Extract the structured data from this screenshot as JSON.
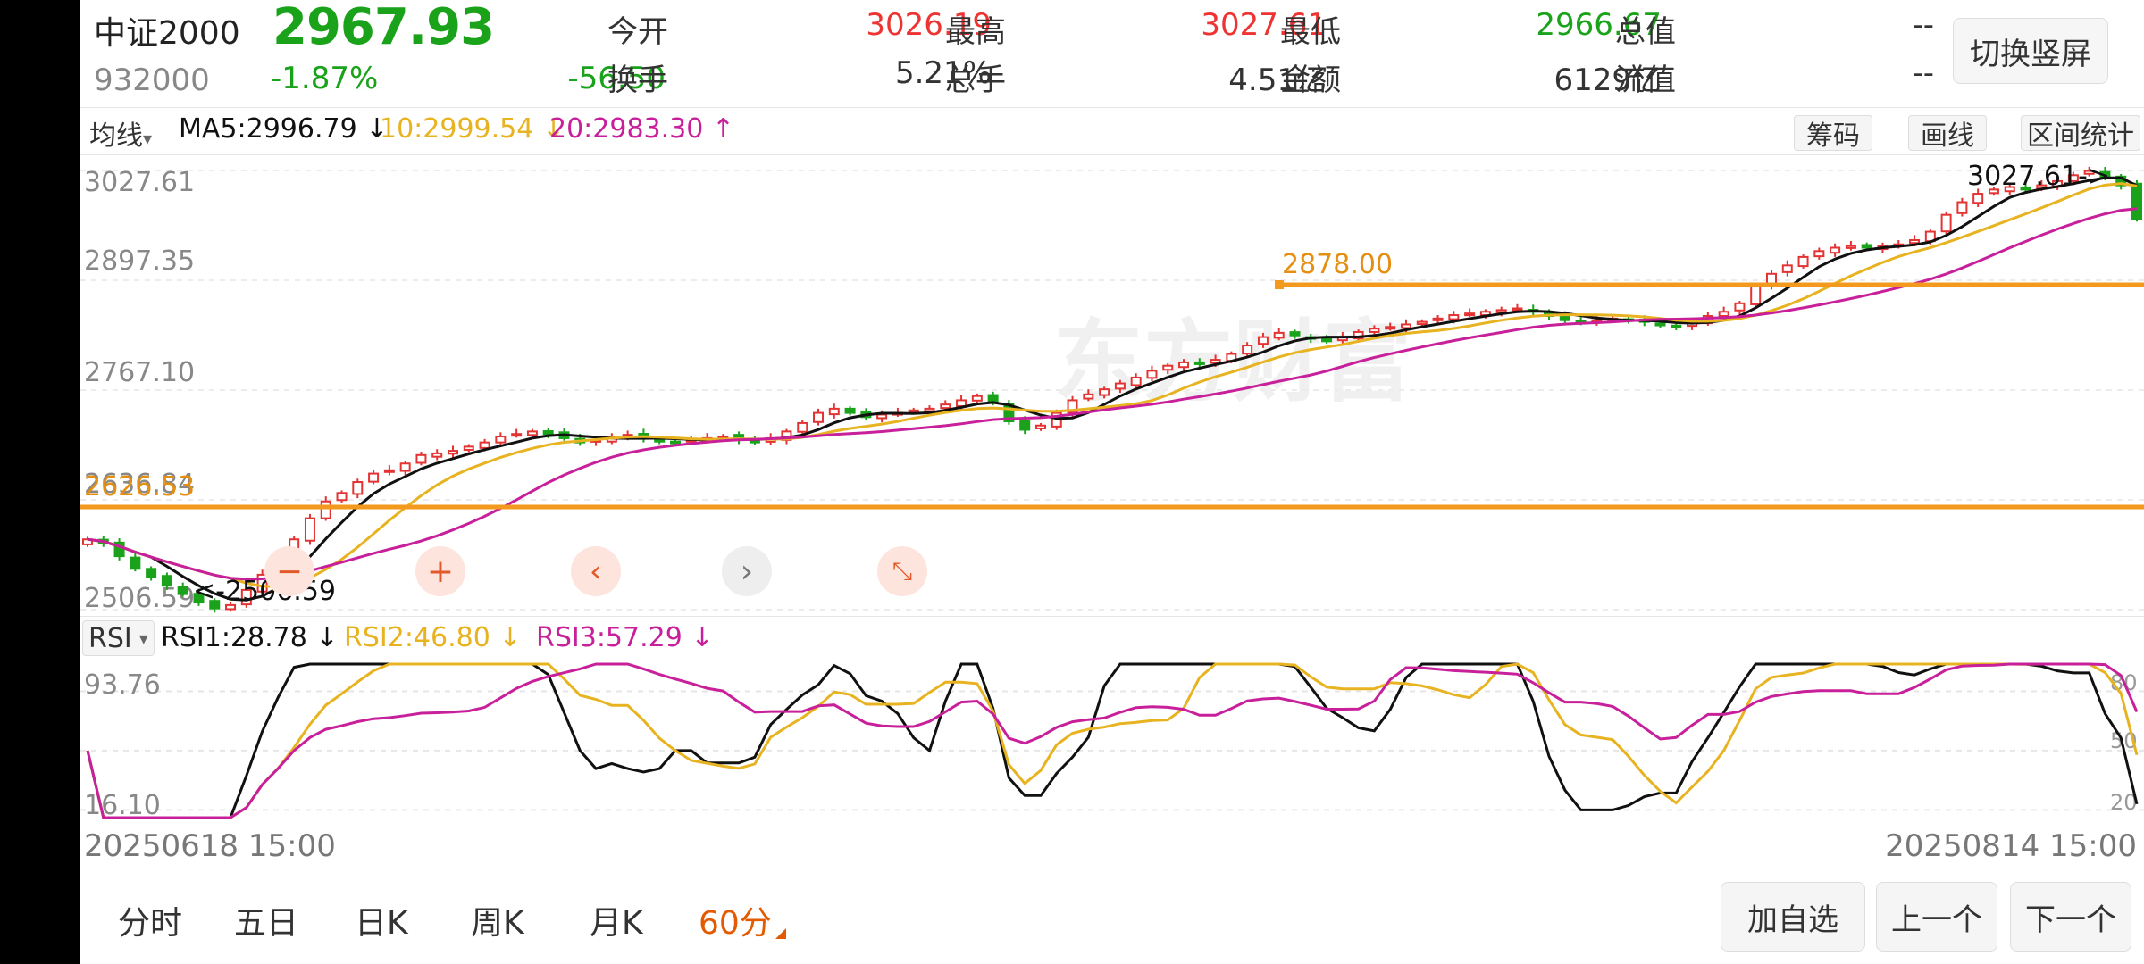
{
  "header": {
    "name": "中证2000",
    "price": "2967.93",
    "code": "932000",
    "change_pct": "-1.87%",
    "change": "-56.50",
    "stats": [
      {
        "label": "今开",
        "value": "3026.19",
        "color": "red"
      },
      {
        "label": "最高",
        "value": "3027.61",
        "color": "red"
      },
      {
        "label": "最低",
        "value": "2966.67",
        "color": "green"
      },
      {
        "label": "总值",
        "value": "--",
        "color": "dark"
      },
      {
        "label": "换手",
        "value": "5.21%",
        "color": "dark"
      },
      {
        "label": "总手",
        "value": "4.51亿",
        "color": "dark"
      },
      {
        "label": "金额",
        "value": "6129亿",
        "color": "dark"
      },
      {
        "label": "流值",
        "value": "--",
        "color": "dark"
      }
    ],
    "switch_button": "切换竖屏"
  },
  "ma_bar": {
    "selector": "均线",
    "selector_caret": "▾",
    "ma5": "MA5:2996.79 ↓",
    "ma10": "10:2999.54 ↓",
    "ma20": "20:2983.30 ↑",
    "tools": [
      "筹码",
      "画线",
      "区间统计"
    ]
  },
  "kchart": {
    "y_labels": [
      "3027.61",
      "2897.35",
      "2767.10",
      "2636.84",
      "2506.59"
    ],
    "hline_top": "2878.00",
    "hline_bottom": "2626.53",
    "max_label": "3027.61->",
    "min_label": "<-2506.59",
    "watermark": "东方财富"
  },
  "chart_data": {
    "type": "candlestick",
    "ylim": [
      2506.59,
      3027.61
    ],
    "yticks": [
      3027.61,
      2897.35,
      2767.1,
      2636.84,
      2506.59
    ],
    "x_start": "20250618 15:00",
    "x_end": "20250814 15:00",
    "horizontal_lines": [
      2878.0,
      2626.53
    ],
    "series": [
      {
        "name": "MA5",
        "last": 2996.79
      },
      {
        "name": "MA10",
        "last": 2999.54
      },
      {
        "name": "MA20",
        "last": 2983.3
      }
    ],
    "close_path": [
      2590,
      2585,
      2570,
      2555,
      2545,
      2535,
      2525,
      2515,
      2508,
      2512,
      2530,
      2548,
      2565,
      2590,
      2615,
      2635,
      2645,
      2658,
      2668,
      2672,
      2680,
      2690,
      2692,
      2695,
      2700,
      2705,
      2712,
      2715,
      2718,
      2715,
      2710,
      2705,
      2708,
      2712,
      2714,
      2710,
      2706,
      2705,
      2708,
      2710,
      2712,
      2708,
      2705,
      2710,
      2718,
      2728,
      2740,
      2745,
      2740,
      2735,
      2738,
      2740,
      2743,
      2745,
      2750,
      2755,
      2760,
      2752,
      2730,
      2720,
      2725,
      2740,
      2755,
      2762,
      2768,
      2775,
      2782,
      2790,
      2796,
      2800,
      2798,
      2803,
      2810,
      2820,
      2830,
      2835,
      2832,
      2828,
      2825,
      2830,
      2836,
      2840,
      2842,
      2845,
      2848,
      2852,
      2856,
      2858,
      2860,
      2862,
      2864,
      2860,
      2855,
      2850,
      2848,
      2850,
      2852,
      2850,
      2848,
      2844,
      2842,
      2848,
      2855,
      2860,
      2870,
      2890,
      2905,
      2915,
      2925,
      2932,
      2936,
      2938,
      2936,
      2938,
      2940,
      2945,
      2955,
      2975,
      2990,
      3000,
      3005,
      3008,
      3005,
      3010,
      3015,
      3022,
      3027,
      3020,
      3010,
      2970
    ]
  },
  "rsi": {
    "selector": "RSI",
    "selector_caret": "▾",
    "rsi1": "RSI1:28.78 ↓",
    "rsi2": "RSI2:46.80 ↓",
    "rsi3": "RSI3:57.29 ↓",
    "y_top": "93.76",
    "y_bottom": "16.10",
    "right_labels": [
      "80",
      "50",
      "20"
    ],
    "chart_data": {
      "type": "line",
      "ylim": [
        16.1,
        93.76
      ],
      "series": [
        {
          "name": "RSI1",
          "last": 28.78
        },
        {
          "name": "RSI2",
          "last": 46.8
        },
        {
          "name": "RSI3",
          "last": 57.29
        }
      ]
    }
  },
  "dates": {
    "start": "20250618 15:00",
    "end": "20250814 15:00"
  },
  "periods": [
    "分时",
    "五日",
    "日K",
    "周K",
    "月K",
    "60分"
  ],
  "active_period": "60分",
  "bottom_buttons": [
    "加自选",
    "上一个",
    "下一个"
  ],
  "float_icons": [
    "minus-icon",
    "plus-icon",
    "chevron-left-icon",
    "chevron-right-icon",
    "collapse-icon"
  ],
  "colors": {
    "up": "#e33333",
    "down": "#1aa21a",
    "ma5": "#111111",
    "ma10": "#e8b320",
    "ma20": "#c8209a",
    "hline": "#f39a1e",
    "active": "#e35a00"
  }
}
